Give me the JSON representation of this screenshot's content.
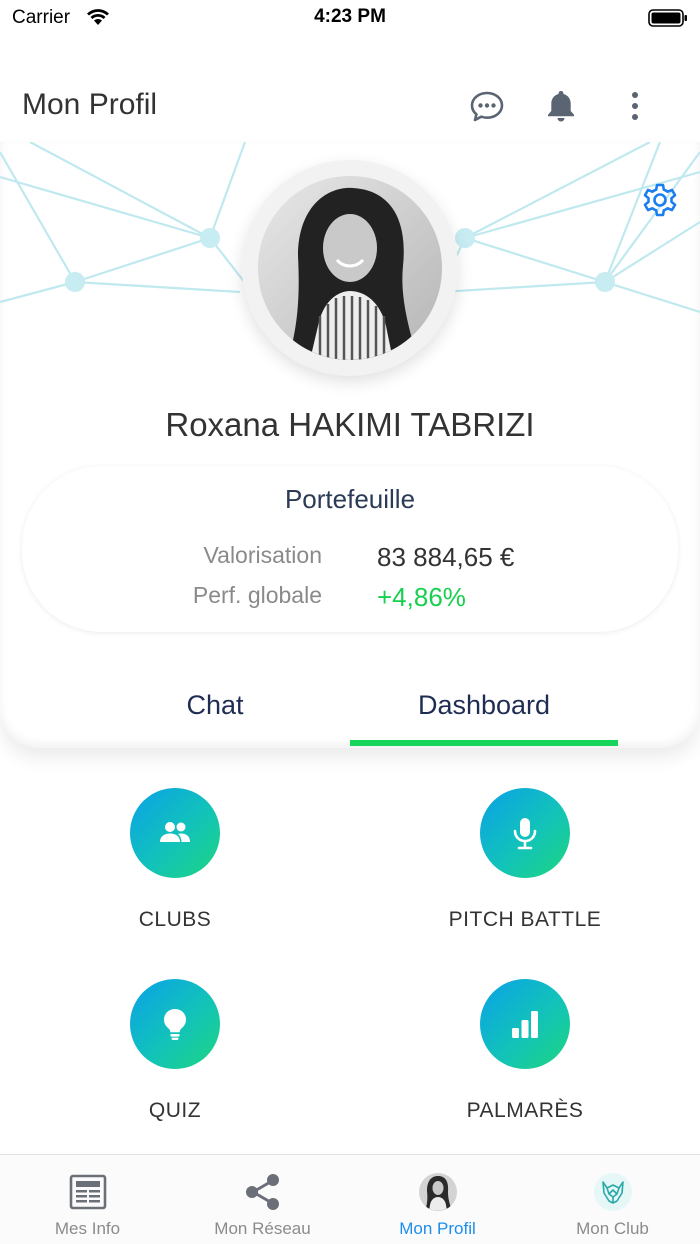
{
  "status_bar": {
    "carrier": "Carrier",
    "time": "4:23 PM"
  },
  "header": {
    "title": "Mon Profil",
    "icons": [
      "chat-icon",
      "bell-icon",
      "more-vertical-icon"
    ]
  },
  "profile": {
    "name": "Roxana HAKIMI TABRIZI",
    "settings_icon": "gear-icon"
  },
  "portfolio": {
    "title": "Portefeuille",
    "valuation_label": "Valorisation",
    "valuation_value": "83 884,65 €",
    "performance_label": "Perf. globale",
    "performance_value": "+4,86%"
  },
  "tabs": [
    {
      "label": "Chat",
      "active": false
    },
    {
      "label": "Dashboard",
      "active": true
    }
  ],
  "dashboard": {
    "items": [
      {
        "label": "CLUBS",
        "icon": "group-icon"
      },
      {
        "label": "PITCH BATTLE",
        "icon": "microphone-icon"
      },
      {
        "label": "QUIZ",
        "icon": "lightbulb-icon"
      },
      {
        "label": "PALMARÈS",
        "icon": "bar-chart-icon"
      }
    ]
  },
  "bottom_nav": {
    "items": [
      {
        "label": "Mes Info",
        "icon": "newspaper-icon",
        "active": false
      },
      {
        "label": "Mon Réseau",
        "icon": "share-icon",
        "active": false
      },
      {
        "label": "Mon Profil",
        "icon": "profile-avatar",
        "active": true
      },
      {
        "label": "Mon Club",
        "icon": "club-logo-icon",
        "active": false
      }
    ]
  },
  "colors": {
    "accent_green": "#17d45a",
    "active_blue": "#1b8ef0",
    "gradient_start": "#0aa1e8",
    "gradient_end": "#1ed57f",
    "tab_text": "#1f2d52"
  }
}
